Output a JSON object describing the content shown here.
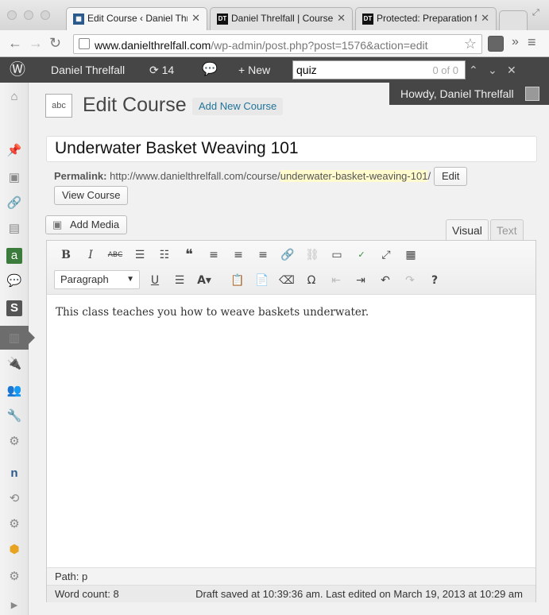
{
  "browser": {
    "tabs": [
      {
        "label": "Edit Course ‹ Daniel Thr",
        "favicon": "wp-grid-icon",
        "active": true
      },
      {
        "label": "Daniel Threlfall | Course",
        "favicon": "dt-logo-icon",
        "active": false
      },
      {
        "label": "Protected: Preparation fo",
        "favicon": "dt-logo-icon",
        "active": false
      }
    ],
    "url_domain": "www.danielthrelfall.com",
    "url_path": "/wp-admin/post.php?post=1576&action=edit"
  },
  "adminbar": {
    "site_name": "Daniel Threlfall",
    "updates_count": "14",
    "new_label": "New",
    "find_query": "quiz",
    "find_count": "0 of 0",
    "howdy": "Howdy, Daniel Threlfall"
  },
  "page": {
    "title": "Edit Course",
    "add_new": "Add New Course",
    "icon_text": "abc"
  },
  "post": {
    "title": "Underwater Basket Weaving 101",
    "permalink_label": "Permalink:",
    "permalink_base": "http://www.danielthrelfall.com/course/",
    "permalink_slug": "underwater-basket-weaving-101",
    "permalink_trail": "/",
    "edit_label": "Edit",
    "view_label": "View Course"
  },
  "editor": {
    "add_media": "Add Media",
    "tab_visual": "Visual",
    "tab_text": "Text",
    "format": "Paragraph",
    "content": "This class teaches you how to weave baskets underwater.",
    "path": "Path: p",
    "word_count": "Word count: 8",
    "save_status": "Draft saved at 10:39:36 am. Last edited on March 19, 2013 at 10:29 am"
  }
}
